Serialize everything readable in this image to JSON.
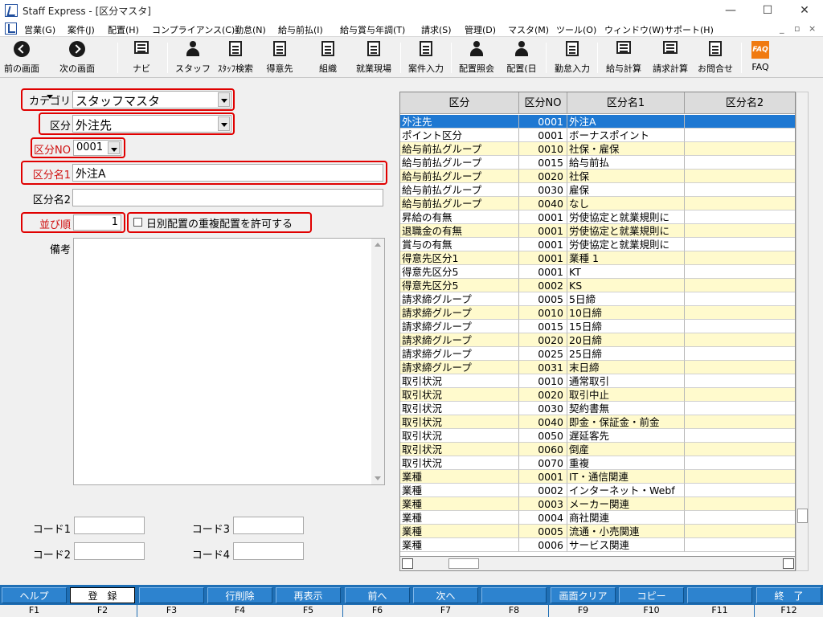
{
  "window": {
    "title": "Staff Express - [区分マスタ]",
    "minimize": "—",
    "maximize": "☐",
    "close": "✕"
  },
  "menu": [
    "営業(G)",
    "案件(J)",
    "配置(H)",
    "コンプライアンス(C)",
    "勤怠(N)",
    "給与前払(I)",
    "給与賞与年調(T)",
    "請求(S)",
    "管理(D)",
    "マスタ(M)",
    "ツール(O)",
    "ウィンドウ(W)",
    "サポート(H)"
  ],
  "mdi": {
    "minimize": "_",
    "restore": "▫",
    "close": "×"
  },
  "toolbar": {
    "back": "前の画面",
    "forward": "次の画面",
    "navi": "ナビ",
    "staff": "スタッフ",
    "staff_search": "ｽﾀｯﾌ検索",
    "client": "得意先",
    "org": "組織",
    "site": "就業現場",
    "case_input": "案件入力",
    "assign_view": "配置照会",
    "assign_day": "配置(日",
    "attendance": "勤怠入力",
    "payroll": "給与計算",
    "billing": "請求計算",
    "contact": "お問合せ",
    "faq": "FAQ",
    "faq_icon_text": "FAQ"
  },
  "form": {
    "category_label": "カテゴリ",
    "category_value": "スタッフマスタ",
    "kubun_label": "区分",
    "kubun_value": "外注先",
    "kubun_no_label": "区分NO",
    "kubun_no_value": "0001",
    "name1_label": "区分名1",
    "name1_value": "外注A",
    "name2_label": "区分名2",
    "name2_value": "",
    "order_label": "並び順",
    "order_value": "1",
    "allow_label": "日別配置の重複配置を許可する",
    "memo_label": "備考",
    "code1_label": "コード1",
    "code2_label": "コード2",
    "code3_label": "コード3",
    "code4_label": "コード4"
  },
  "grid": {
    "headers": [
      "区分",
      "区分NO",
      "区分名1",
      "区分名2"
    ],
    "rows": [
      [
        "外注先",
        "0001",
        "外注A",
        ""
      ],
      [
        "ポイント区分",
        "0001",
        "ボーナスポイント",
        ""
      ],
      [
        "給与前払グループ",
        "0010",
        "社保・雇保",
        ""
      ],
      [
        "給与前払グループ",
        "0015",
        "給与前払",
        ""
      ],
      [
        "給与前払グループ",
        "0020",
        "社保",
        ""
      ],
      [
        "給与前払グループ",
        "0030",
        "雇保",
        ""
      ],
      [
        "給与前払グループ",
        "0040",
        "なし",
        ""
      ],
      [
        "昇給の有無",
        "0001",
        "労使協定と就業規則に",
        ""
      ],
      [
        "退職金の有無",
        "0001",
        "労使協定と就業規則に",
        ""
      ],
      [
        "賞与の有無",
        "0001",
        "労使協定と就業規則に",
        ""
      ],
      [
        "得意先区分1",
        "0001",
        "業種 1",
        ""
      ],
      [
        "得意先区分5",
        "0001",
        "KT",
        ""
      ],
      [
        "得意先区分5",
        "0002",
        "KS",
        ""
      ],
      [
        "請求締グループ",
        "0005",
        "5日締",
        ""
      ],
      [
        "請求締グループ",
        "0010",
        "10日締",
        ""
      ],
      [
        "請求締グループ",
        "0015",
        "15日締",
        ""
      ],
      [
        "請求締グループ",
        "0020",
        "20日締",
        ""
      ],
      [
        "請求締グループ",
        "0025",
        "25日締",
        ""
      ],
      [
        "請求締グループ",
        "0031",
        "末日締",
        ""
      ],
      [
        "取引状況",
        "0010",
        "通常取引",
        ""
      ],
      [
        "取引状況",
        "0020",
        "取引中止",
        ""
      ],
      [
        "取引状況",
        "0030",
        "契約書無",
        ""
      ],
      [
        "取引状況",
        "0040",
        "即金・保証金・前金",
        ""
      ],
      [
        "取引状況",
        "0050",
        "遅延客先",
        ""
      ],
      [
        "取引状況",
        "0060",
        "倒産",
        ""
      ],
      [
        "取引状況",
        "0070",
        "重複",
        ""
      ],
      [
        "業種",
        "0001",
        "IT・通信関連",
        ""
      ],
      [
        "業種",
        "0002",
        "インターネット・Webf",
        ""
      ],
      [
        "業種",
        "0003",
        "メーカー関連",
        ""
      ],
      [
        "業種",
        "0004",
        "商社関連",
        ""
      ],
      [
        "業種",
        "0005",
        "流通・小売関連",
        ""
      ],
      [
        "業種",
        "0006",
        "サービス関連",
        ""
      ]
    ]
  },
  "fkeys": [
    {
      "label": "ヘルプ",
      "key": "F1"
    },
    {
      "label": "登　録",
      "key": "F2"
    },
    {
      "label": "",
      "key": "F3"
    },
    {
      "label": "行削除",
      "key": "F4"
    },
    {
      "label": "再表示",
      "key": "F5"
    },
    {
      "label": "前へ",
      "key": "F6"
    },
    {
      "label": "次へ",
      "key": "F7"
    },
    {
      "label": "",
      "key": "F8"
    },
    {
      "label": "画面クリア",
      "key": "F9"
    },
    {
      "label": "コピー",
      "key": "F10"
    },
    {
      "label": "",
      "key": "F11"
    },
    {
      "label": "終　了",
      "key": "F12"
    }
  ],
  "colors": {
    "selected_row": "#1e78d2",
    "alt_row": "#fffacd",
    "fkey_bar": "#1f6fb5",
    "required_label": "#d01010",
    "highlight_box": "#e00000"
  }
}
